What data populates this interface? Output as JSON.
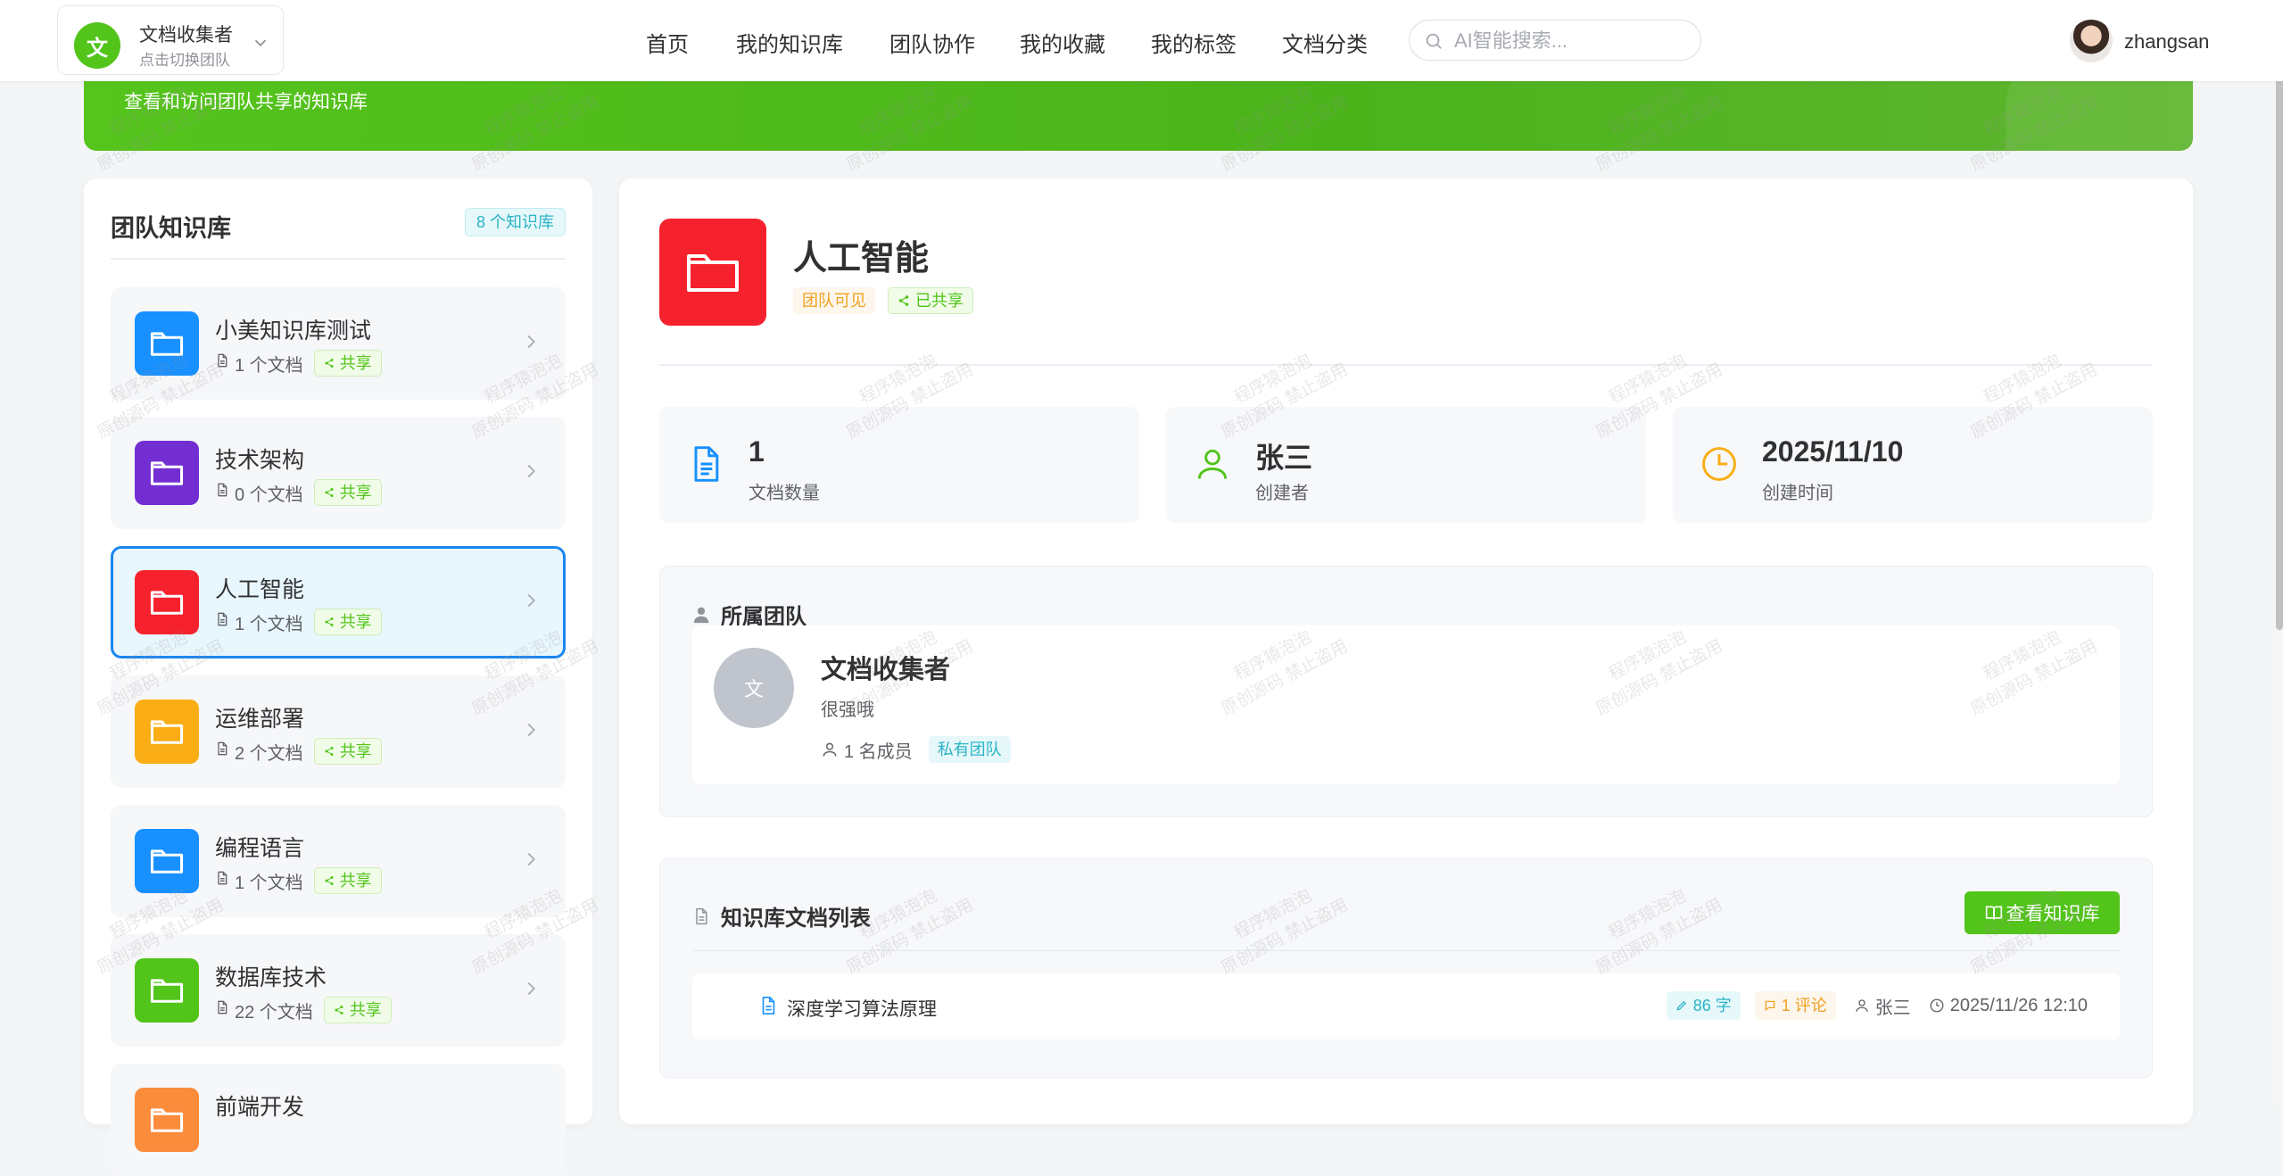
{
  "topbar": {
    "team_logo_char": "文",
    "team_name": "文档收集者",
    "team_hint": "点击切换团队",
    "nav": [
      "首页",
      "我的知识库",
      "团队协作",
      "我的收藏",
      "我的标签",
      "文档分类"
    ],
    "search_placeholder": "AI智能搜索...",
    "username": "zhangsan"
  },
  "banner": {
    "subtitle": "查看和访问团队共享的知识库"
  },
  "sidebar": {
    "title": "团队知识库",
    "count_label": "8 个知识库",
    "items": [
      {
        "name": "小美知识库测试",
        "docs": "1 个文档",
        "share": "共享",
        "color": "#1890ff"
      },
      {
        "name": "技术架构",
        "docs": "0 个文档",
        "share": "共享",
        "color": "#722ed1"
      },
      {
        "name": "人工智能",
        "docs": "1 个文档",
        "share": "共享",
        "color": "#f5222d",
        "active": true
      },
      {
        "name": "运维部署",
        "docs": "2 个文档",
        "share": "共享",
        "color": "#faad14"
      },
      {
        "name": "编程语言",
        "docs": "1 个文档",
        "share": "共享",
        "color": "#1890ff"
      },
      {
        "name": "数据库技术",
        "docs": "22 个文档",
        "share": "共享",
        "color": "#52c41a"
      },
      {
        "name": "前端开发",
        "docs": "",
        "share": "",
        "color": "#fa8c3c"
      }
    ]
  },
  "detail": {
    "title": "人工智能",
    "tag_visibility": "团队可见",
    "tag_shared": "已共享",
    "icon_color": "#f5222d",
    "stats": [
      {
        "value": "1",
        "label": "文档数量",
        "icon": "document-icon",
        "color": "#1890ff"
      },
      {
        "value": "张三",
        "label": "创建者",
        "icon": "user-icon",
        "color": "#52c41a"
      },
      {
        "value": "2025/11/10",
        "label": "创建时间",
        "icon": "clock-icon",
        "color": "#faad14"
      }
    ],
    "team_section": {
      "title": "所属团队",
      "avatar_char": "文",
      "name": "文档收集者",
      "desc": "很强哦",
      "members": "1 名成员",
      "type_tag": "私有团队"
    },
    "docs_section": {
      "title": "知识库文档列表",
      "view_button": "查看知识库",
      "docs": [
        {
          "title": "深度学习算法原理",
          "words": "86 字",
          "comments": "1 评论",
          "author": "张三",
          "time": "2025/11/26 12:10"
        }
      ]
    }
  },
  "watermark": {
    "line1": "程序猿泡泡",
    "line2": "原创源码 禁止盗用"
  },
  "colors": {
    "primary": "#52c41a",
    "active_border": "#1b87f0"
  }
}
